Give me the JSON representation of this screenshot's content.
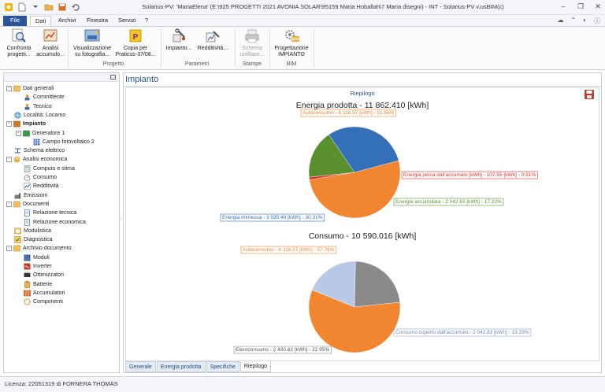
{
  "window": {
    "title": "Solarius-PV: 'MariaElena' (E:\\925 PROGETTI 2021 AVONIA SOLAR\\95159 Maria Hoballah\\7 Maria disegni) - INT - Solarius-PV  v.usBIM(c)"
  },
  "menu": {
    "items": [
      "File",
      "Dati",
      "Archivi",
      "Finestra",
      "Servizi",
      "?"
    ]
  },
  "ribbon": {
    "buttons": [
      {
        "label1": "Confronta",
        "label2": "progetti..."
      },
      {
        "label1": "Analisi",
        "label2": "accumulo..."
      },
      {
        "label1": "Visualizzazione",
        "label2": "su fotografia..."
      },
      {
        "label1": "Copia per",
        "label2": "Praticus-37/08..."
      },
      {
        "label1": "Impianto...",
        "label2": ""
      },
      {
        "label1": "Redditività...",
        "label2": ""
      },
      {
        "label1": "Schema",
        "label2": "unifilare..."
      },
      {
        "label1": "Progettazione",
        "label2": "IMPIANTO"
      }
    ],
    "groups": [
      "Progetto",
      "Parametri",
      "Stampe",
      "BIM"
    ]
  },
  "tree": {
    "items": [
      "Dati generali",
      "Committente",
      "Tecnico",
      "Località: Locarno",
      "Impianto",
      "Generatore 1",
      "Campo fotovoltaico 2",
      "Schema elettrico",
      "Analisi economica",
      "Computo e stima",
      "Consumo",
      "Redditività",
      "Emissioni",
      "Documenti",
      "Relazione tecnica",
      "Relazione economica",
      "Modulistica",
      "Diagnostica",
      "Archivio documento",
      "Moduli",
      "Inverter",
      "Ottimizzatori",
      "Batterie",
      "Accumulatori",
      "Componenti"
    ]
  },
  "main": {
    "title": "Impianto",
    "subtitle": "Riepilogo",
    "tabs": [
      "Generale",
      "Energia prodotta",
      "Specifiche",
      "Riepilogo"
    ]
  },
  "status": {
    "license": "Licenza: 22051319 di FORNERA THOMAS"
  },
  "chart_data": [
    {
      "type": "pie",
      "title": "Energia prodotta - 11 862.410 [kWh]",
      "slices": [
        {
          "label": "Autoconsumo - 6 116.57 [kWh] - 51.56%",
          "value": 51.56,
          "color": "#f28530"
        },
        {
          "label": "Energia persa dall'accumulo [kWh] - 107.55 [kWh] - 0.91%",
          "value": 0.91,
          "color": "#e0302a"
        },
        {
          "label": "Energia accumulata - 2 042.83 [kWh] - 17.22%",
          "value": 17.22,
          "color": "#5a8f2e"
        },
        {
          "label": "Energia immessa - 3 595.49 [kWh] - 30.31%",
          "value": 30.31,
          "color": "#3470b8"
        }
      ]
    },
    {
      "type": "pie",
      "title": "Consumo - 10 590.016 [kWh]",
      "slices": [
        {
          "label": "Autoconsumo - 6 116.57 [kWh] - 57.76%",
          "value": 57.76,
          "color": "#f28530"
        },
        {
          "label": "Consumo coperto dall'accumulo - 2 042.83 [kWh] - 19.29%",
          "value": 19.29,
          "color": "#b8c9e8"
        },
        {
          "label": "Eteroconsumo - 2 430.62 [kWh] - 22.95%",
          "value": 22.95,
          "color": "#8a8a8a"
        }
      ]
    }
  ]
}
